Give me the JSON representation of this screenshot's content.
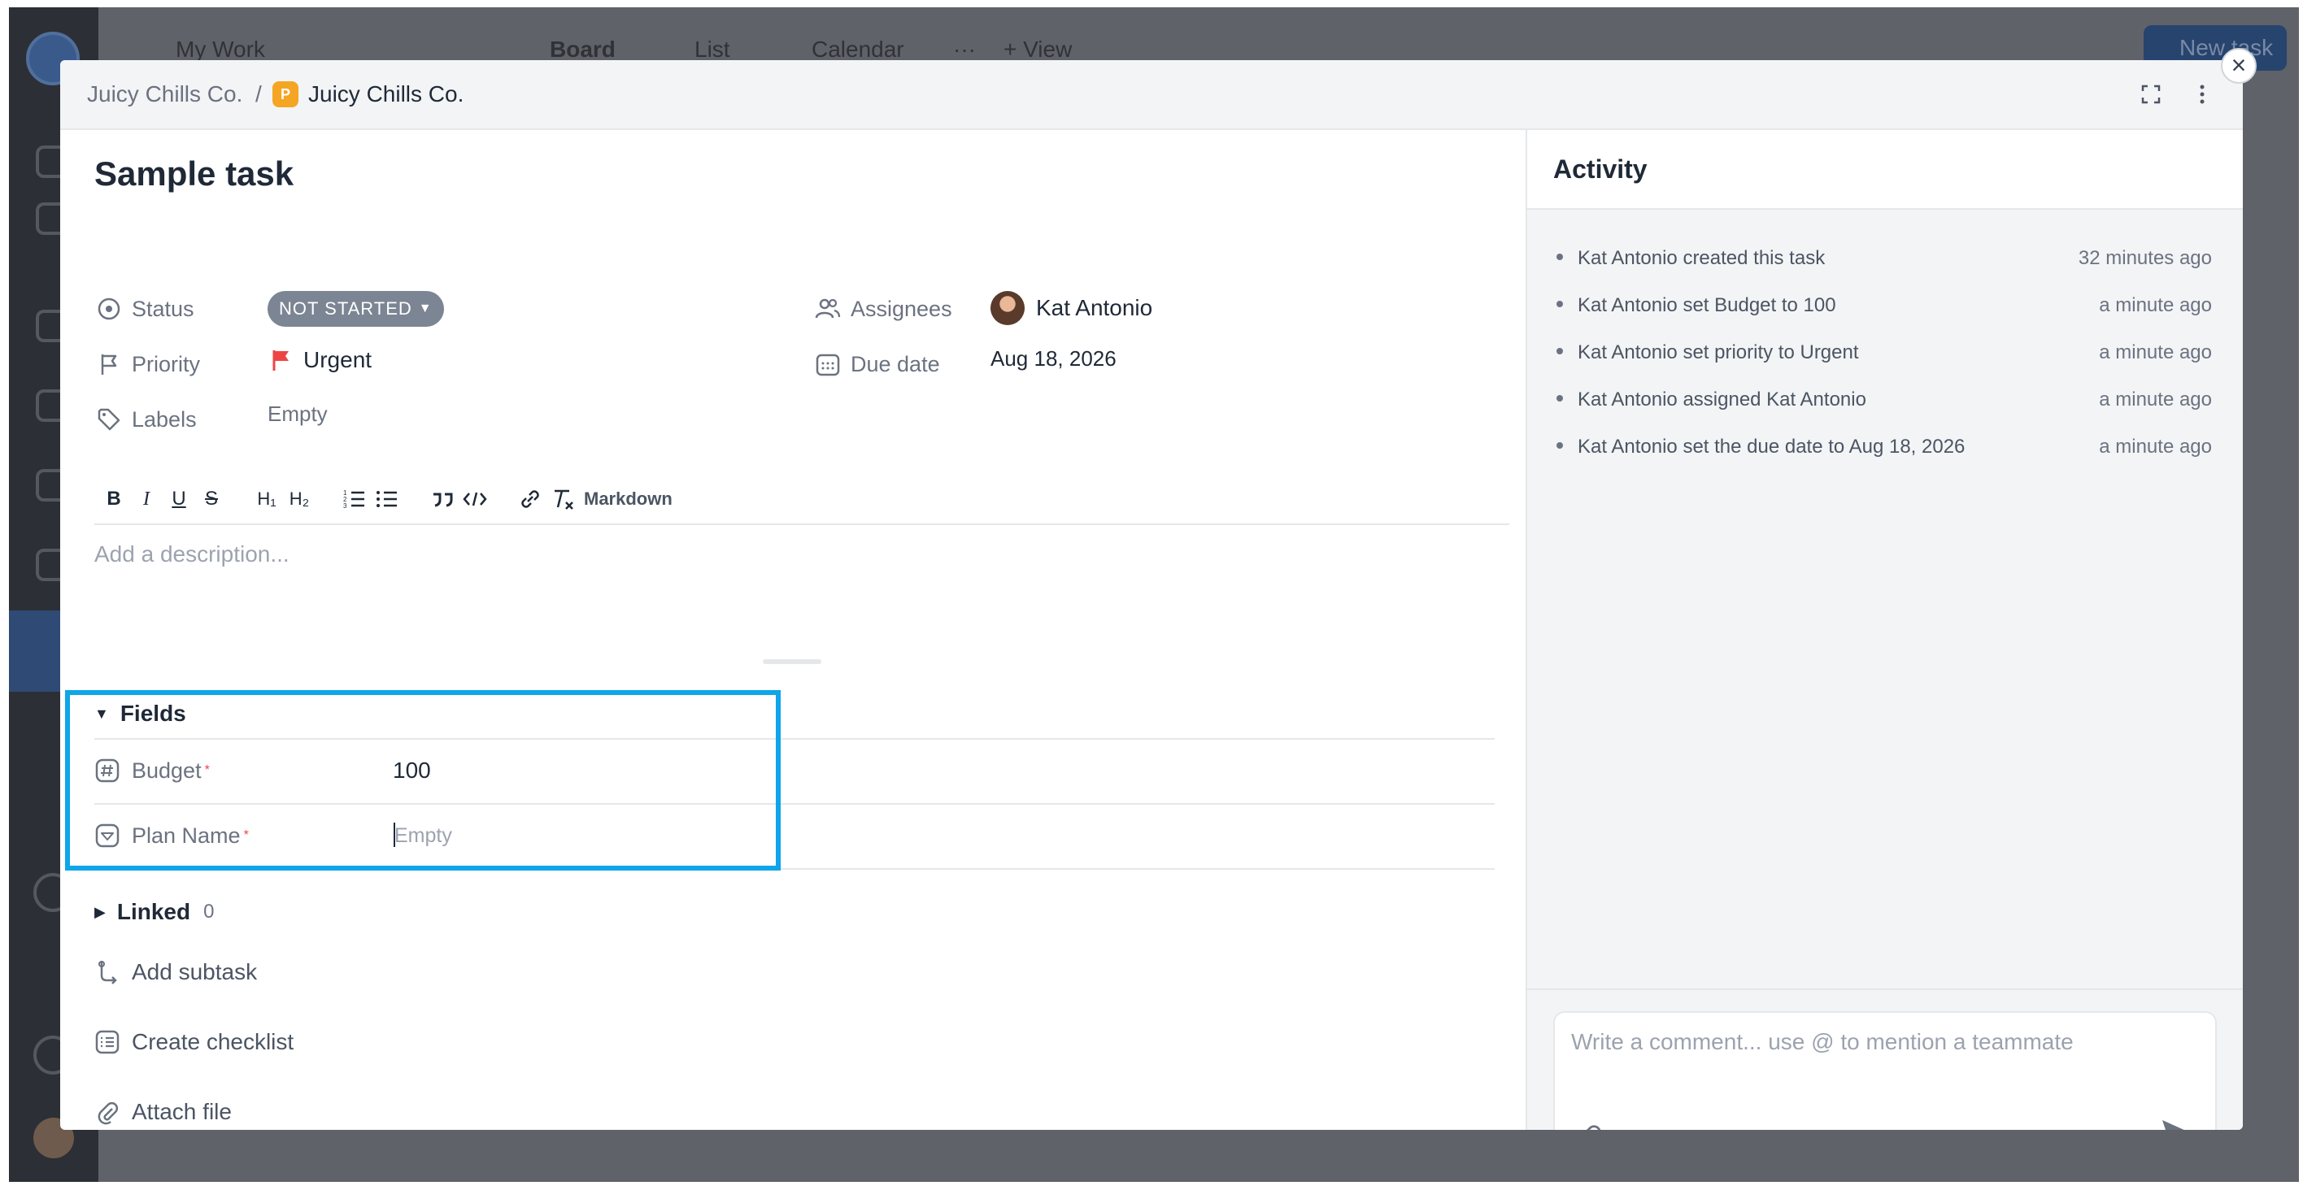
{
  "background_app": {
    "workspace_title": "My Work",
    "views": [
      "Board",
      "List",
      "Calendar"
    ],
    "more": "···",
    "add_view": "+ View",
    "new_task": "New task"
  },
  "modal": {
    "breadcrumb": {
      "parent": "Juicy Chills Co.",
      "separator": "/",
      "badge": "P",
      "current": "Juicy Chills Co."
    },
    "task_title": "Sample task",
    "properties": {
      "status": {
        "label": "Status",
        "value": "NOT STARTED"
      },
      "priority": {
        "label": "Priority",
        "value": "Urgent"
      },
      "labels": {
        "label": "Labels",
        "value": "Empty"
      },
      "assignees": {
        "label": "Assignees",
        "value": "Kat Antonio"
      },
      "due_date": {
        "label": "Due date",
        "value": "Aug 18, 2026"
      }
    },
    "editor": {
      "toolbar": {
        "bold": "B",
        "italic": "I",
        "underline": "U",
        "strike": "S",
        "h1": "H₁",
        "h2": "H₂",
        "markdown": "Markdown"
      },
      "placeholder": "Add a description..."
    },
    "fields": {
      "title": "Fields",
      "items": [
        {
          "label": "Budget",
          "required": "*",
          "value": "100"
        },
        {
          "label": "Plan Name",
          "required": "*",
          "value": "Empty"
        }
      ]
    },
    "linked": {
      "title": "Linked",
      "count": "0"
    },
    "actions": {
      "add_subtask": "Add subtask",
      "create_checklist": "Create checklist",
      "attach_file": "Attach file"
    },
    "activity": {
      "title": "Activity",
      "items": [
        {
          "actor": "Kat Antonio",
          "text": "created this task",
          "target": "",
          "time": "32 minutes ago"
        },
        {
          "actor": "Kat Antonio",
          "text": "set Budget to 100",
          "target": "",
          "time": "a minute ago"
        },
        {
          "actor": "Kat Antonio",
          "text": "set priority to Urgent",
          "target": "",
          "time": "a minute ago"
        },
        {
          "actor": "Kat Antonio",
          "text": "assigned Kat Antonio",
          "target": "",
          "time": "a minute ago"
        },
        {
          "actor": "Kat Antonio",
          "text": "set the due date to Aug 18, 2026",
          "target": "",
          "time": "a minute ago"
        }
      ],
      "comment_placeholder": "Write a comment... use @ to mention a teammate"
    },
    "colors": {
      "accent": "#0ea5e9",
      "status_pill": "#7c8593",
      "urgent_flag": "#ef4444",
      "badge": "#f5a524"
    }
  }
}
